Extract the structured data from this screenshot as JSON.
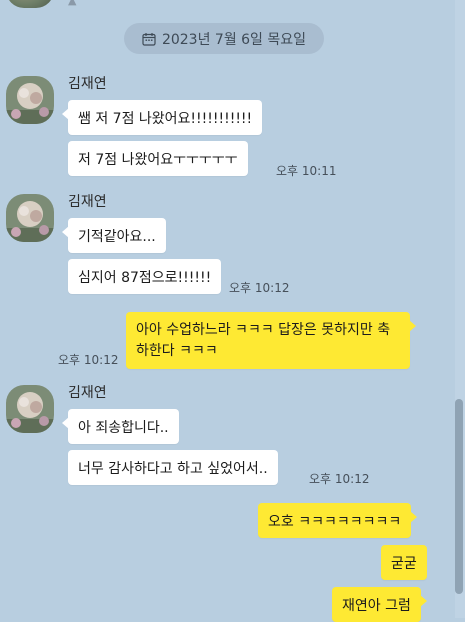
{
  "date_divider": {
    "label": "2023년 7월 6일 목요일",
    "icon": "calendar-icon"
  },
  "contact": {
    "name": "김재연"
  },
  "messages": [
    {
      "text": "쌤 저 7점 나왔어요!!!!!!!!!!!"
    },
    {
      "text": "저 7점 나왔어요ㅜㅜㅜㅜㅜ",
      "time": "오후 10:11"
    },
    {
      "text": "기적같아요..."
    },
    {
      "text": "심지어 87점으로!!!!!!",
      "time": "오후 10:12"
    },
    {
      "text": "아아 수업하느라 ㅋㅋㅋ 답장은 못하지만 축하한다 ㅋㅋㅋ",
      "time": "오후 10:12"
    },
    {
      "text": "아 죄송합니다.."
    },
    {
      "text": "너무 감사하다고 하고 싶었어서..",
      "time": "오후 10:12"
    },
    {
      "text": "오호 ㅋㅋㅋㅋㅋㅋㅋㅋ"
    },
    {
      "text": "굳굳"
    },
    {
      "text": "재연아 그럼"
    }
  ],
  "colors": {
    "background": "#b8cee0",
    "my_bubble": "#fee933",
    "their_bubble": "#ffffff"
  }
}
